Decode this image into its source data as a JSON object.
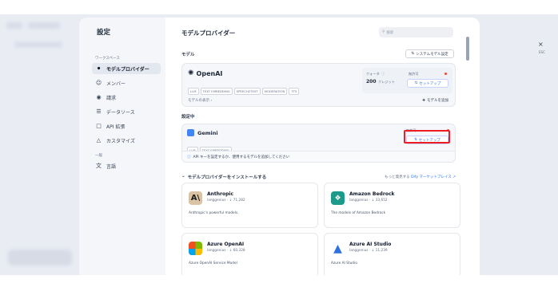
{
  "sidebar": {
    "title": "設定",
    "group_workspace": "ワークスペース",
    "group_general": "一般",
    "items": [
      {
        "label": "モデルプロバイダー",
        "icon": "model-icon"
      },
      {
        "label": "メンバー",
        "icon": "members-icon"
      },
      {
        "label": "請求",
        "icon": "billing-icon"
      },
      {
        "label": "データソース",
        "icon": "database-icon"
      },
      {
        "label": "API 拡張",
        "icon": "api-icon"
      },
      {
        "label": "カスタマイズ",
        "icon": "customize-icon"
      },
      {
        "label": "言語",
        "icon": "language-icon"
      }
    ]
  },
  "main": {
    "title": "モデルプロバイダー",
    "search_placeholder": "検索",
    "model_section": "モデル",
    "system_model_btn": "システムモデル設定",
    "openai": {
      "name": "OpenAI",
      "tags": [
        "LLM",
        "TEXT EMBEDDING",
        "SPEECH2TEXT",
        "MODERATION",
        "TTS"
      ],
      "quota_label": "クォータ",
      "quota_value": "200",
      "quota_unit": "クレジット",
      "status": "無許可",
      "setup": "セットアップ",
      "show_models": "モデルの表示",
      "add_model": "モデルを追加"
    },
    "configuring_section": "設定中",
    "gemini": {
      "name": "Gemini",
      "tags": [
        "LLM",
        "TEXT EMBEDDING"
      ],
      "status": "無許可",
      "setup": "セットアップ",
      "info": "API キーを設定するか、使用するモデルを追加してください"
    },
    "install_section": "モデルプロバイダーをインストールする",
    "marketplace_prefix": "もっと発見する",
    "marketplace_link": "Dify マーケットプレイス",
    "providers": [
      {
        "name": "Anthropic",
        "author": "langgenius",
        "downloads": "71,282",
        "desc": "Anthropic's powerful models."
      },
      {
        "name": "Amazon Bedrock",
        "author": "langgenius",
        "downloads": "33,652",
        "desc": "The models of Amazon Bedrock"
      },
      {
        "name": "Azure OpenAI",
        "author": "langgenius",
        "downloads": "60,328",
        "desc": "Azure OpenAI Service Model"
      },
      {
        "name": "Azure AI Studio",
        "author": "langgenius",
        "downloads": "11,239",
        "desc": "Azure AI Studio"
      }
    ]
  },
  "close": {
    "icon": "×",
    "label": "ESC"
  },
  "colors": {
    "accent": "#2970ff",
    "highlight": "#ee1c25",
    "status_red": "#f04438"
  }
}
